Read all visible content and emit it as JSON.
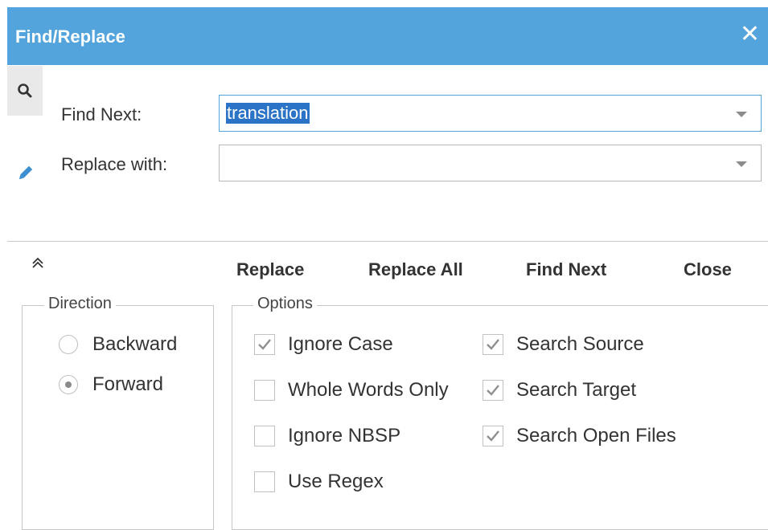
{
  "dialog": {
    "title": "Find/Replace",
    "close_glyph": "✕"
  },
  "side_tabs": [
    {
      "name": "find",
      "icon": "search-icon",
      "active": true
    },
    {
      "name": "replace",
      "icon": "pencil-icon",
      "active": false
    }
  ],
  "find": {
    "label": "Find Next:",
    "value": "translation"
  },
  "replace": {
    "label": "Replace with:",
    "value": ""
  },
  "actions": {
    "replace": "Replace",
    "replace_all": "Replace All",
    "find_next": "Find Next",
    "close": "Close"
  },
  "direction": {
    "legend": "Direction",
    "backward": {
      "label": "Backward",
      "checked": false
    },
    "forward": {
      "label": "Forward",
      "checked": true
    }
  },
  "options": {
    "legend": "Options",
    "ignore_case": {
      "label": "Ignore Case",
      "checked": true
    },
    "whole_words": {
      "label": "Whole Words Only",
      "checked": false
    },
    "ignore_nbsp": {
      "label": "Ignore NBSP",
      "checked": false
    },
    "use_regex": {
      "label": "Use Regex",
      "checked": false
    },
    "search_source": {
      "label": "Search Source",
      "checked": true
    },
    "search_target": {
      "label": "Search Target",
      "checked": true
    },
    "search_open_files": {
      "label": "Search Open Files",
      "checked": true
    }
  },
  "colors": {
    "accent": "#53a4dc",
    "selection": "#2a73c6",
    "check_mark": "#8f8f8f"
  }
}
